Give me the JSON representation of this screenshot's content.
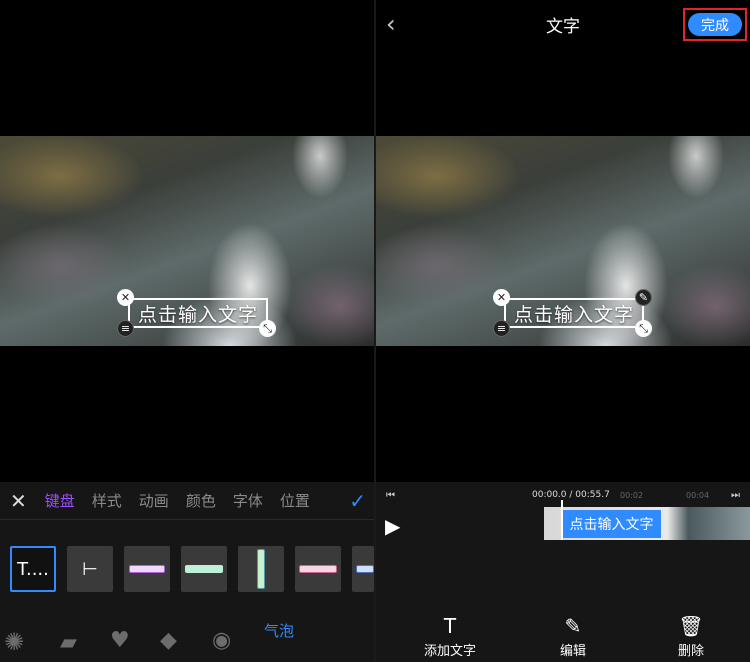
{
  "left_panel": {
    "overlay_text": "点击输入文字",
    "toolbar": {
      "close_icon": "close-icon",
      "tabs": [
        {
          "label": "键盘",
          "active": true
        },
        {
          "label": "样式",
          "active": false
        },
        {
          "label": "动画",
          "active": false
        },
        {
          "label": "颜色",
          "active": false
        },
        {
          "label": "字体",
          "active": false
        },
        {
          "label": "位置",
          "active": false
        }
      ],
      "confirm_icon": "check-icon",
      "default_template_label": "T....",
      "bubble_tab_label": "气泡"
    }
  },
  "right_panel": {
    "header": {
      "title": "文字",
      "done_label": "完成"
    },
    "overlay_text": "点击输入文字",
    "timeline": {
      "current_time": "00:00.0",
      "total_time": "00:55.7",
      "ticks": [
        "00:02",
        "00:04"
      ],
      "clip_label": "点击输入文字"
    },
    "actions": [
      {
        "label": "添加文字",
        "icon": "text-icon"
      },
      {
        "label": "编辑",
        "icon": "edit-icon"
      },
      {
        "label": "删除",
        "icon": "trash-icon"
      }
    ]
  },
  "colors": {
    "accent_blue": "#2f8bff",
    "active_purple": "#9b4dff",
    "highlight_red": "#e0252b",
    "panel_bg": "#161616"
  }
}
